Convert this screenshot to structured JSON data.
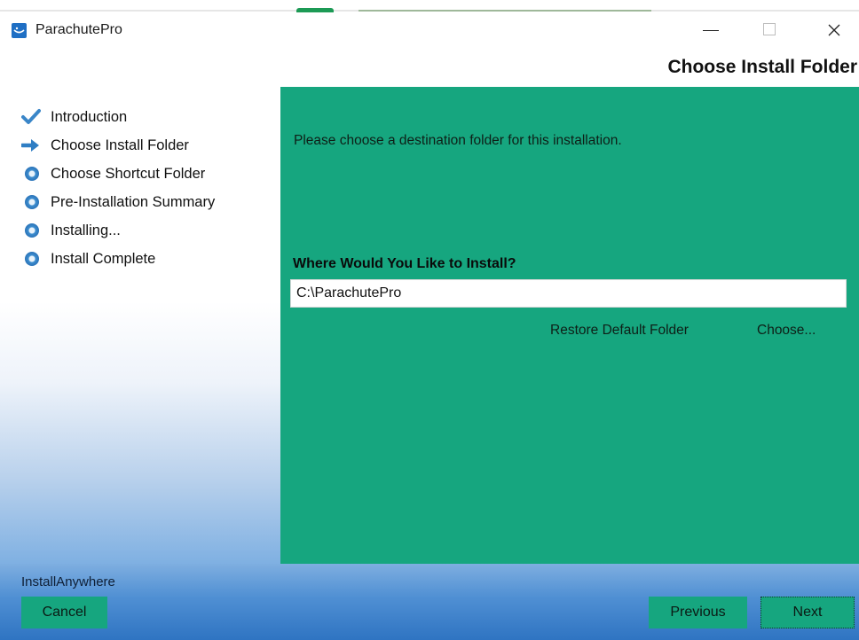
{
  "window": {
    "title": "ParachutePro"
  },
  "header": {
    "title": "Choose Install Folder"
  },
  "steps": [
    {
      "label": "Introduction",
      "status": "done",
      "icon": "checkmark-icon"
    },
    {
      "label": "Choose Install Folder",
      "status": "current",
      "icon": "arrow-right-icon"
    },
    {
      "label": "Choose Shortcut Folder",
      "status": "pending",
      "icon": "bullet-icon"
    },
    {
      "label": "Pre-Installation Summary",
      "status": "pending",
      "icon": "bullet-icon"
    },
    {
      "label": "Installing...",
      "status": "pending",
      "icon": "bullet-icon"
    },
    {
      "label": "Install Complete",
      "status": "pending",
      "icon": "bullet-icon"
    }
  ],
  "main": {
    "prompt": "Please choose a destination folder for this installation.",
    "field_label": "Where Would You Like to Install?",
    "path_value": "C:\\ParachutePro",
    "restore_label": "Restore Default Folder",
    "choose_label": "Choose..."
  },
  "footer": {
    "brand": "InstallAnywhere",
    "cancel_label": "Cancel",
    "previous_label": "Previous",
    "next_label": "Next"
  },
  "colors": {
    "panel_green": "#16a67f",
    "accent_blue": "#2a73b8",
    "footer_blue": "#4f8fd3"
  }
}
